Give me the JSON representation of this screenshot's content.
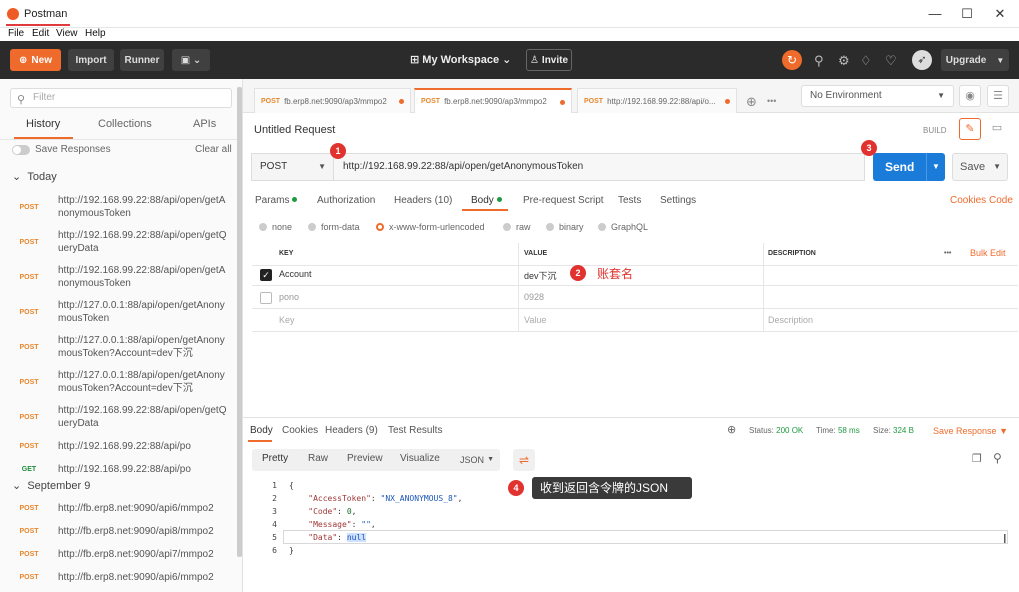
{
  "window": {
    "title": "Postman",
    "menu": [
      "File",
      "Edit",
      "View",
      "Help"
    ],
    "controls": [
      "—",
      "☐",
      "✕"
    ]
  },
  "toolbar": {
    "new": "New",
    "import": "Import",
    "runner": "Runner",
    "workspace": "My Workspace",
    "invite": "Invite",
    "upgrade": "Upgrade"
  },
  "sidebar": {
    "filter_placeholder": "Filter",
    "tabs": [
      "History",
      "Collections",
      "APIs"
    ],
    "save_responses": "Save Responses",
    "clear_all": "Clear all",
    "today": "Today",
    "today_items": [
      {
        "method": "POST",
        "url": "http://192.168.99.22:88/api/open/getAnonymousToken"
      },
      {
        "method": "POST",
        "url": "http://192.168.99.22:88/api/open/getQueryData"
      },
      {
        "method": "POST",
        "url": "http://192.168.99.22:88/api/open/getAnonymousToken"
      },
      {
        "method": "POST",
        "url": "http://127.0.0.1:88/api/open/getAnonymousToken"
      },
      {
        "method": "POST",
        "url": "http://127.0.0.1:88/api/open/getAnonymousToken?Account=dev下沉"
      },
      {
        "method": "POST",
        "url": "http://127.0.0.1:88/api/open/getAnonymousToken?Account=dev下沉"
      },
      {
        "method": "POST",
        "url": "http://192.168.99.22:88/api/open/getQueryData"
      },
      {
        "method": "POST",
        "url": "http://192.168.99.22:88/api/po"
      },
      {
        "method": "GET",
        "url": "http://192.168.99.22:88/api/po"
      }
    ],
    "sep9": "September 9",
    "sep9_items": [
      {
        "method": "POST",
        "url": "http://fb.erp8.net:9090/api6/mmpo2"
      },
      {
        "method": "POST",
        "url": "http://fb.erp8.net:9090/api8/mmpo2"
      },
      {
        "method": "POST",
        "url": "http://fb.erp8.net:9090/api7/mmpo2"
      },
      {
        "method": "POST",
        "url": "http://fb.erp8.net:9090/api6/mmpo2"
      }
    ]
  },
  "request_tabs": [
    {
      "method": "POST",
      "label": "fb.erp8.net:9090/ap3/mmpo2"
    },
    {
      "method": "POST",
      "label": "fb.erp8.net:9090/ap3/mmpo2"
    },
    {
      "method": "POST",
      "label": "http://192.168.99.22:88/api/o..."
    }
  ],
  "environment": "No Environment",
  "request": {
    "title": "Untitled Request",
    "build": "BUILD",
    "method": "POST",
    "url": "http://192.168.99.22:88/api/open/getAnonymousToken",
    "send": "Send",
    "save": "Save",
    "tabs": [
      "Params",
      "Authorization",
      "Headers (10)",
      "Body",
      "Pre-request Script",
      "Tests",
      "Settings"
    ],
    "links": [
      "Cookies",
      "Code"
    ],
    "body_types": [
      "none",
      "form-data",
      "x-www-form-urlencoded",
      "raw",
      "binary",
      "GraphQL"
    ],
    "kv_head": [
      "KEY",
      "VALUE",
      "DESCRIPTION",
      "•••",
      "Bulk Edit"
    ],
    "kv_rows": [
      {
        "key": "Account",
        "value": "dev下沉",
        "checked": true
      },
      {
        "key": "pono",
        "value": "0928",
        "checked": false
      }
    ],
    "kv_placeholder": {
      "key": "Key",
      "value": "Value",
      "desc": "Description"
    }
  },
  "annotations": {
    "b1": "1",
    "b2": "2",
    "b3": "3",
    "b4": "4",
    "account_name": "账套名",
    "json_note": "收到返回含令牌的JSON"
  },
  "response": {
    "tabs": [
      "Body",
      "Cookies",
      "Headers (9)",
      "Test Results"
    ],
    "status_label": "Status:",
    "status": "200 OK",
    "time_label": "Time:",
    "time": "58 ms",
    "size_label": "Size:",
    "size": "324 B",
    "save_response": "Save Response",
    "views": [
      "Pretty",
      "Raw",
      "Preview",
      "Visualize"
    ],
    "format": "JSON",
    "lines": [
      "1",
      "2",
      "3",
      "4",
      "5",
      "6"
    ],
    "code": {
      "open": "{",
      "k1": "\"AccessToken\"",
      "v1": "\"NX_ANONYMOUS_8\"",
      "k2": "\"Code\"",
      "v2": "0",
      "k3": "\"Message\"",
      "v3": "\"\"",
      "k4": "\"Data\"",
      "v4": "null",
      "close": "}"
    }
  },
  "colors": {
    "accent": "#ef6b2c",
    "send": "#1a7bd8",
    "badge": "#e0322f",
    "toolbar": "#2b2b2b"
  }
}
